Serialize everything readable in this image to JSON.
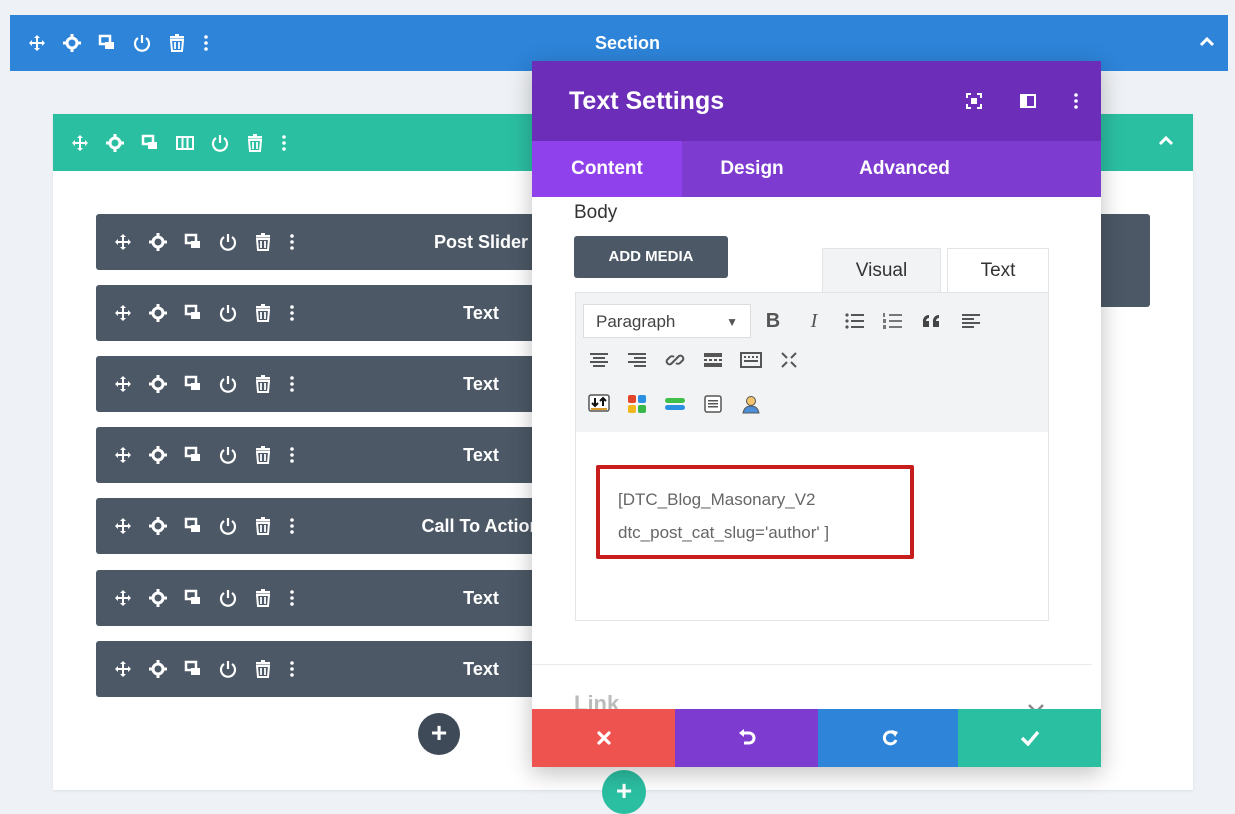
{
  "section": {
    "title": "Section"
  },
  "modules": [
    {
      "label": "Post Slider"
    },
    {
      "label": "Text"
    },
    {
      "label": "Text"
    },
    {
      "label": "Text"
    },
    {
      "label": "Call To Action"
    },
    {
      "label": "Text"
    },
    {
      "label": "Text"
    }
  ],
  "modal": {
    "title": "Text Settings",
    "tabs": [
      {
        "label": "Content"
      },
      {
        "label": "Design"
      },
      {
        "label": "Advanced"
      }
    ],
    "active_tab": "Content",
    "body_label": "Body",
    "add_media_label": "ADD MEDIA",
    "editor_tabs": {
      "visual": "Visual",
      "text": "Text"
    },
    "format_select": {
      "value": "Paragraph"
    },
    "content_lines": [
      "[DTC_Blog_Masonary_V2",
      "dtc_post_cat_slug='author' ]"
    ],
    "link_label": "Link"
  },
  "add_button_glyph": "+",
  "colors": {
    "section_bar": "#2d84d9",
    "row_bar": "#2bbfa2",
    "module_bg": "#4c5866",
    "modal_header": "#6c2eb9",
    "modal_tabs": "#7e3bd0",
    "cancel": "#ef5350",
    "undo": "#7e3bd0",
    "redo": "#2d84d9",
    "save": "#2bbfa2",
    "highlight_border": "#c81d1d"
  },
  "icons": {
    "toolbar": [
      "move-icon",
      "gear-icon",
      "duplicate-icon",
      "power-icon",
      "trash-icon",
      "more-icon"
    ],
    "row_toolbar": [
      "move-icon",
      "gear-icon",
      "duplicate-icon",
      "columns-icon",
      "power-icon",
      "trash-icon",
      "more-icon"
    ],
    "modal_header": [
      "fullscreen-icon",
      "split-view-icon",
      "more-icon"
    ],
    "actions": [
      "close-icon",
      "undo-icon",
      "redo-icon",
      "check-icon"
    ]
  }
}
